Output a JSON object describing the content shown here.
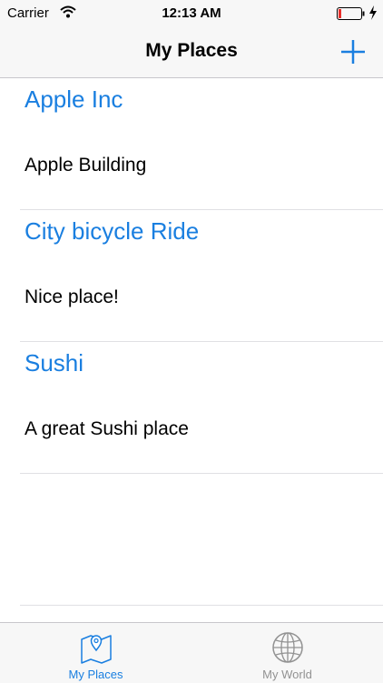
{
  "status_bar": {
    "carrier": "Carrier",
    "time": "12:13 AM",
    "icons": [
      "wifi-icon",
      "battery-icon",
      "charging-icon"
    ]
  },
  "nav": {
    "title": "My Places",
    "add_icon": "plus-icon"
  },
  "places": [
    {
      "title": "Apple Inc",
      "subtitle": "Apple Building"
    },
    {
      "title": "City bicycle Ride",
      "subtitle": "Nice place!"
    },
    {
      "title": "Sushi",
      "subtitle": "A great Sushi place"
    }
  ],
  "tabs": [
    {
      "label": "My Places",
      "icon": "map-pin-icon",
      "active": true
    },
    {
      "label": "My World",
      "icon": "globe-icon",
      "active": false
    }
  ],
  "colors": {
    "accent": "#1a7fe0",
    "inactive_tab": "#929292",
    "battery_low": "#e8302b"
  }
}
